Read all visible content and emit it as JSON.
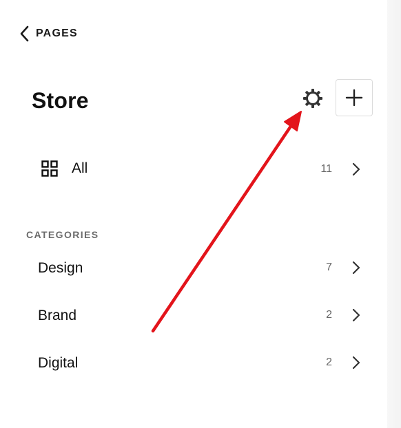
{
  "nav": {
    "back_label": "PAGES"
  },
  "header": {
    "title": "Store"
  },
  "all_row": {
    "label": "All",
    "count": "11"
  },
  "categories": {
    "section_label": "CATEGORIES",
    "items": [
      {
        "label": "Design",
        "count": "7"
      },
      {
        "label": "Brand",
        "count": "2"
      },
      {
        "label": "Digital",
        "count": "2"
      }
    ]
  },
  "icons": {
    "back": "chevron-left-icon",
    "settings": "gear-icon",
    "add": "plus-icon",
    "all": "grid-icon",
    "row": "chevron-right-icon"
  },
  "colors": {
    "annotation_arrow": "#e3141b",
    "text_primary": "#111111",
    "text_muted": "#666666"
  }
}
